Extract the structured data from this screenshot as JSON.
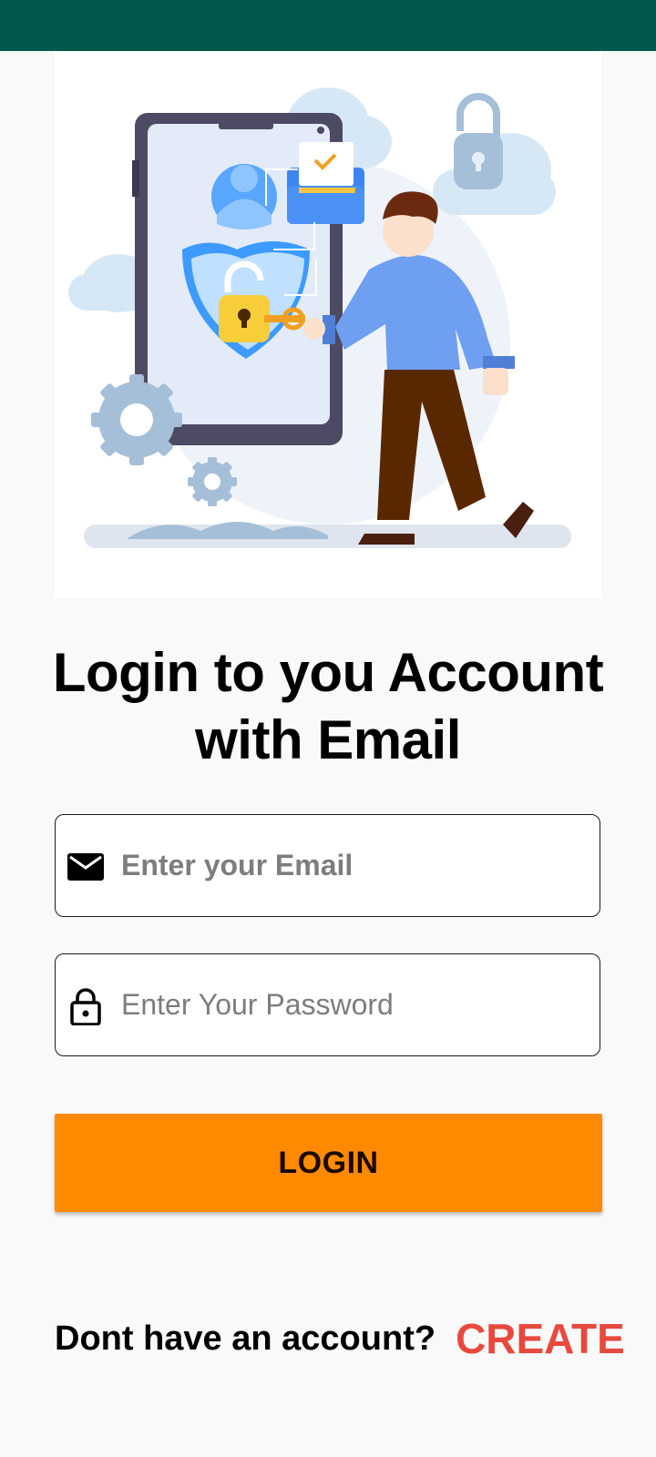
{
  "status_bar": {
    "color": "#02584a"
  },
  "hero": {
    "image": "login-security-illustration"
  },
  "heading": {
    "line1": "Login to you Account",
    "line2": "with Email"
  },
  "email_field": {
    "placeholder": "Enter your Email",
    "value": "",
    "icon": "mail-icon"
  },
  "password_field": {
    "placeholder": "Enter Your Password",
    "value": "",
    "icon": "lock-icon"
  },
  "login_button": {
    "label": "LOGIN",
    "color": "#ff8a00"
  },
  "footer": {
    "prompt": "Dont have an account?",
    "create_label": "CREATE",
    "create_color": "#e8493e"
  }
}
